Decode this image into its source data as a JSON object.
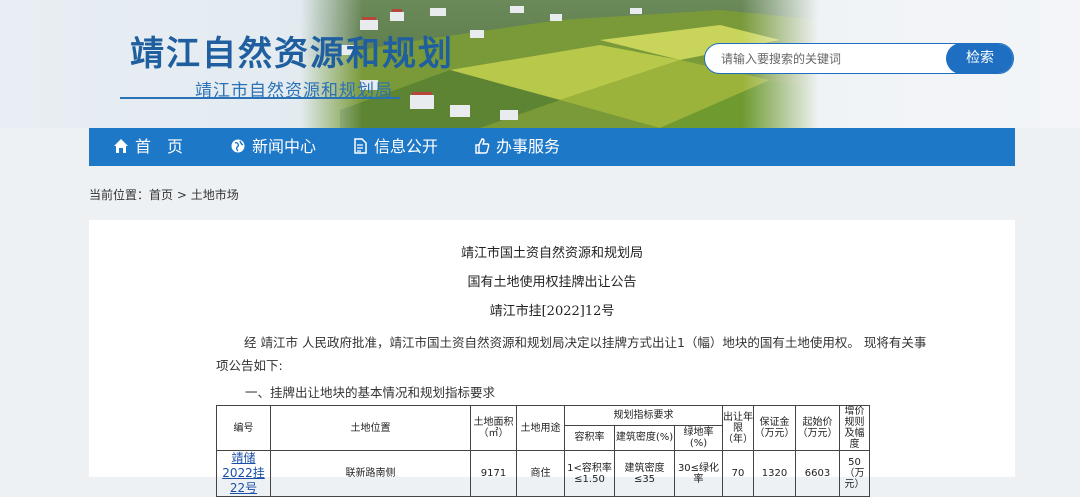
{
  "header": {
    "site_title": "靖江自然资源和规划",
    "site_subtitle": "靖江市自然资源和规划局"
  },
  "search": {
    "placeholder": "请输入要搜索的关键词",
    "button_label": "检索"
  },
  "nav": {
    "items": [
      {
        "label": "首　页",
        "icon": "home-icon"
      },
      {
        "label": "新闻中心",
        "icon": "globe-icon"
      },
      {
        "label": "信息公开",
        "icon": "document-icon"
      },
      {
        "label": "办事服务",
        "icon": "thumbs-up-icon"
      }
    ]
  },
  "breadcrumb": {
    "prefix": "当前位置：",
    "home": "首页",
    "separator": ">",
    "current": "土地市场"
  },
  "document": {
    "issuer": "靖江市国土资自然资源和规划局",
    "title": "国有土地使用权挂牌出让公告",
    "number": "靖江市挂[2022]12号",
    "paragraph_line1": "经 靖江市 人民政府批准，靖江市国土资自然资源和规划局决定以挂牌方式出让1（幅）地块的国有土地使用权。 现将有关事",
    "paragraph_line2": "项公告如下:",
    "section1": "一、挂牌出让地块的基本情况和规划指标要求"
  },
  "table": {
    "headers": {
      "code": "编号",
      "location": "土地位置",
      "area": "土地面积（㎡）",
      "use": "土地用途",
      "planning": "规划指标要求",
      "far": "容积率",
      "density": "建筑密度(%)",
      "green": "绿地率(%)",
      "term": "出让年限（年）",
      "deposit": "保证金（万元）",
      "start_price": "起始价（万元）",
      "increment": "增价规则及幅度"
    },
    "rows": [
      {
        "code": "靖储2022挂22号",
        "location": "联新路南侧",
        "area": "9171",
        "use": "商住",
        "far": "1<容积率≤1.50",
        "density": "建筑密度≤35",
        "green": "30≤绿化率",
        "term": "70",
        "deposit": "1320",
        "start_price": "6603",
        "increment": "50（万元）"
      }
    ]
  },
  "colors": {
    "brand_blue": "#1e78c8",
    "title_blue": "#1f5e9f",
    "page_bg": "#eef1f4"
  }
}
